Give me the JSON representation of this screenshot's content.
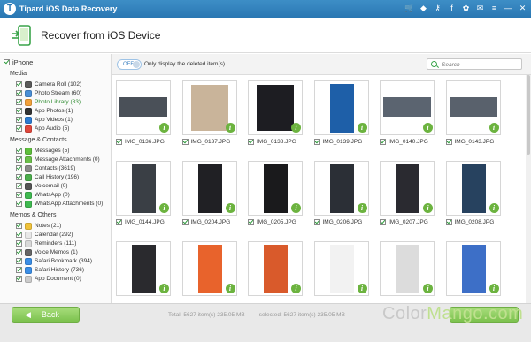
{
  "window": {
    "title": "Tipard iOS Data Recovery"
  },
  "header": {
    "title": "Recover from iOS Device"
  },
  "sidebar": {
    "root": "iPhone",
    "sections": [
      {
        "label": "Media",
        "items": [
          {
            "label": "Camera Roll (102)",
            "color": "#5a5a5a"
          },
          {
            "label": "Photo Stream (60)",
            "color": "#4a8fd6"
          },
          {
            "label": "Photo Library (83)",
            "color": "#f2a23a",
            "active": true
          },
          {
            "label": "App Photos (1)",
            "color": "#333333"
          },
          {
            "label": "App Videos (1)",
            "color": "#2c7bd1"
          },
          {
            "label": "App Audio (5)",
            "color": "#e0473c"
          }
        ]
      },
      {
        "label": "Message & Contacts",
        "items": [
          {
            "label": "Messages (5)",
            "color": "#5fbf3c"
          },
          {
            "label": "Message Attachments (0)",
            "color": "#6bbf4a"
          },
          {
            "label": "Contacts (3619)",
            "color": "#8a8a8a"
          },
          {
            "label": "Call History (196)",
            "color": "#4cae4c"
          },
          {
            "label": "Voicemail (0)",
            "color": "#555555"
          },
          {
            "label": "WhatsApp (0)",
            "color": "#3fb950"
          },
          {
            "label": "WhatsApp Attachments (0)",
            "color": "#3fb950"
          }
        ]
      },
      {
        "label": "Memos & Others",
        "items": [
          {
            "label": "Notes (21)",
            "color": "#f0c23a"
          },
          {
            "label": "Calendar (292)",
            "color": "#e8e8e8"
          },
          {
            "label": "Reminders (111)",
            "color": "#d9d9d9"
          },
          {
            "label": "Voice Memos (1)",
            "color": "#666666"
          },
          {
            "label": "Safari Bookmark (394)",
            "color": "#3a8ee6"
          },
          {
            "label": "Safari History (736)",
            "color": "#3a8ee6"
          },
          {
            "label": "App Document (0)",
            "color": "#cccccc"
          }
        ]
      }
    ]
  },
  "toolbar": {
    "toggle": "OFF",
    "toggle_label": "Only display the deleted item(s)",
    "search_placeholder": "Search"
  },
  "files": [
    {
      "name": "IMG_0136.JPG",
      "bg": "#ffffff",
      "img": "#4a5058",
      "kind": "wide"
    },
    {
      "name": "IMG_0137.JPG",
      "bg": "#ffffff",
      "img": "#c9b49a",
      "kind": "photo"
    },
    {
      "name": "IMG_0138.JPG",
      "bg": "#ffffff",
      "img": "#1d1d22",
      "kind": "photo"
    },
    {
      "name": "IMG_0139.JPG",
      "bg": "#ffffff",
      "img": "#1e5fa8",
      "kind": "phone"
    },
    {
      "name": "IMG_0140.JPG",
      "bg": "#ffffff",
      "img": "#5b6470",
      "kind": "wide"
    },
    {
      "name": "IMG_0143.JPG",
      "bg": "#ffffff",
      "img": "#59616c",
      "kind": "wide"
    },
    {
      "name": "IMG_0144.JPG",
      "bg": "#ffffff",
      "img": "#3a3f45",
      "kind": "phone"
    },
    {
      "name": "IMG_0204.JPG",
      "bg": "#ffffff",
      "img": "#202024",
      "kind": "phone"
    },
    {
      "name": "IMG_0205.JPG",
      "bg": "#ffffff",
      "img": "#1a1a1c",
      "kind": "phone"
    },
    {
      "name": "IMG_0206.JPG",
      "bg": "#ffffff",
      "img": "#2b2f36",
      "kind": "phone"
    },
    {
      "name": "IMG_0207.JPG",
      "bg": "#ffffff",
      "img": "#2a2a30",
      "kind": "phone"
    },
    {
      "name": "IMG_0208.JPG",
      "bg": "#ffffff",
      "img": "#27425f",
      "kind": "phone"
    },
    {
      "name": "",
      "bg": "#ffffff",
      "img": "#2a2a2e",
      "kind": "phone"
    },
    {
      "name": "",
      "bg": "#ffffff",
      "img": "#e8632c",
      "kind": "phone"
    },
    {
      "name": "",
      "bg": "#ffffff",
      "img": "#d95a2b",
      "kind": "phone"
    },
    {
      "name": "",
      "bg": "#ffffff",
      "img": "#f2f2f2",
      "kind": "phone"
    },
    {
      "name": "",
      "bg": "#ffffff",
      "img": "#dcdcdc",
      "kind": "phone"
    },
    {
      "name": "",
      "bg": "#ffffff",
      "img": "#3d6fc7",
      "kind": "phone"
    }
  ],
  "footer": {
    "back_label": "Back",
    "total": "Total: 5627 item(s) 235.05 MB",
    "selected": "selected: 5627 item(s) 235.05 MB",
    "watermark_a": "Color",
    "watermark_b": "Mango.com"
  },
  "colors": {
    "accent_green": "#7cc24e",
    "title_blue": "#2a77b3"
  }
}
